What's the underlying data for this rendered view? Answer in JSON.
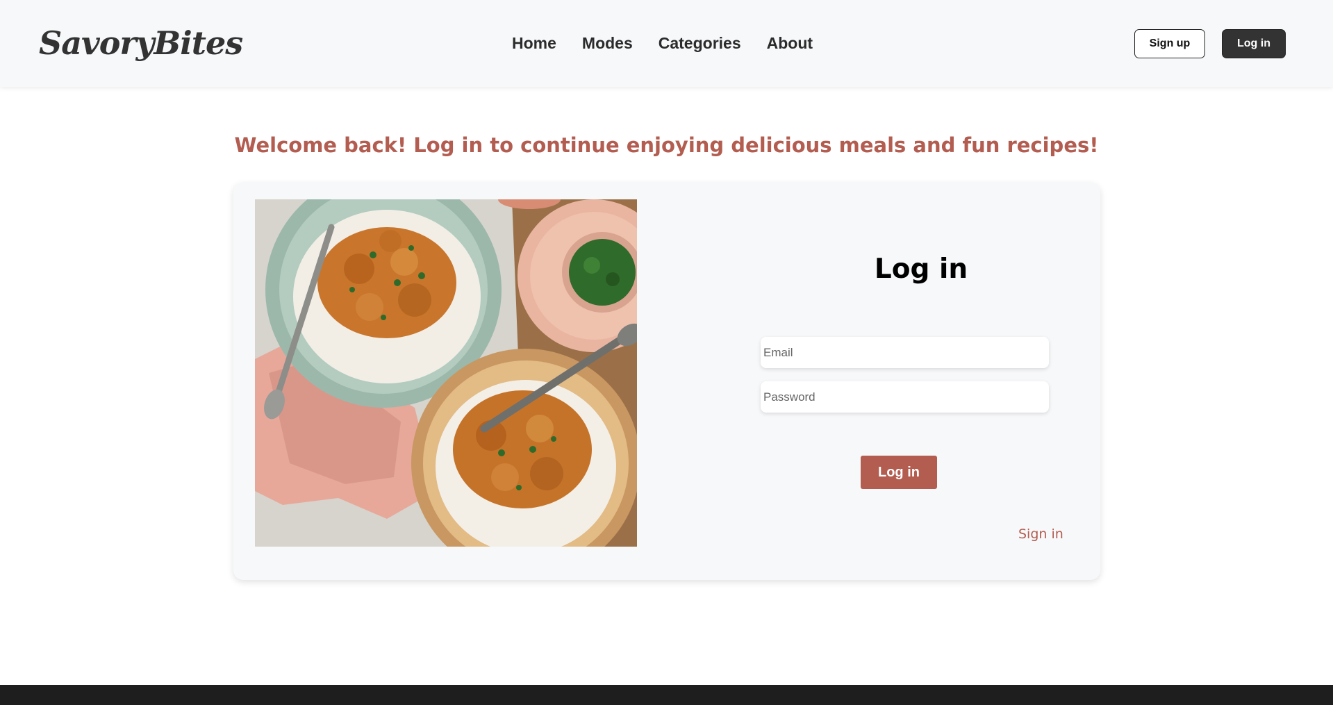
{
  "header": {
    "logo": "SavoryBites",
    "nav": [
      {
        "label": "Home"
      },
      {
        "label": "Modes"
      },
      {
        "label": "Categories"
      },
      {
        "label": "About"
      }
    ],
    "signup_label": "Sign up",
    "login_label": "Log in"
  },
  "main": {
    "welcome": "Welcome back! Log in to continue enjoying delicious meals and fun recipes!",
    "form": {
      "title": "Log in",
      "email_placeholder": "Email",
      "password_placeholder": "Password",
      "submit_label": "Log in",
      "signin_link": "Sign in"
    }
  },
  "colors": {
    "accent": "#b35c50",
    "header_bg": "#f7f8fa",
    "dark_button": "#333333",
    "footer_bg": "#1e1e1e"
  },
  "image": {
    "icon": "food-photo"
  }
}
